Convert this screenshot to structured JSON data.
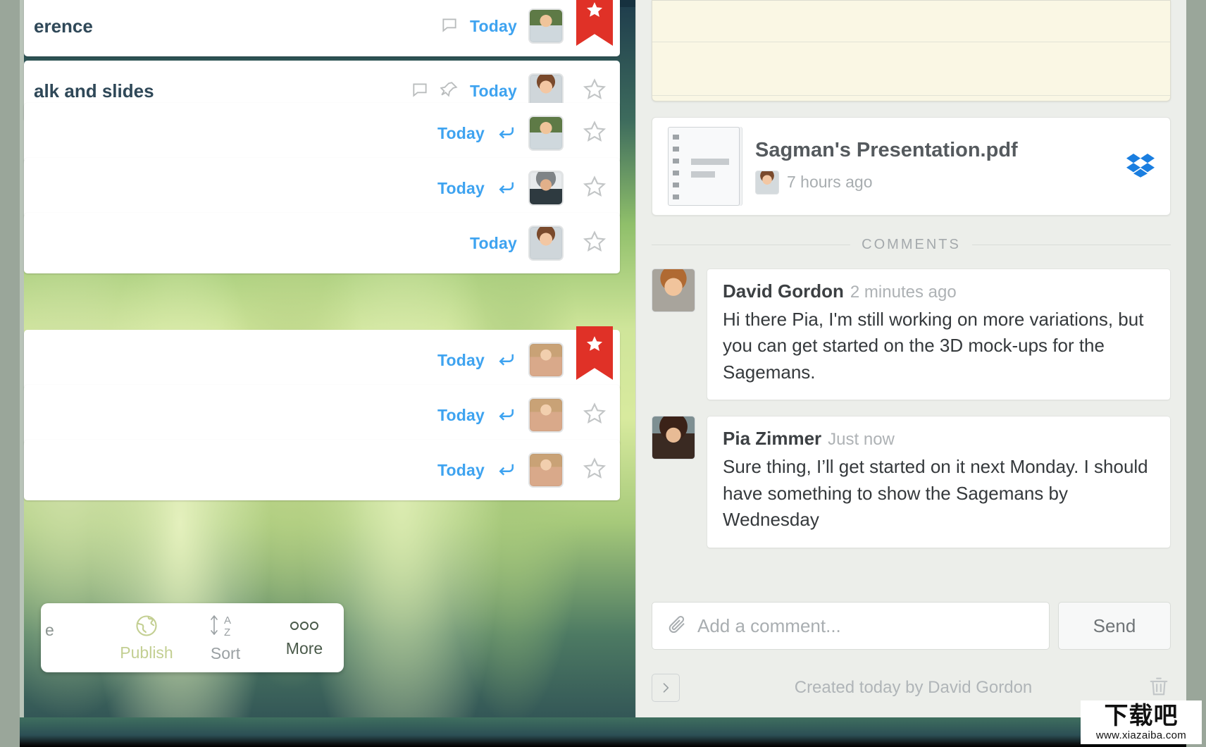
{
  "app": {
    "name": "Wunderlist task detail"
  },
  "left_panel": {
    "rows": [
      {
        "title": "erence",
        "date": "Today",
        "has_comment_icon": true,
        "has_pin_icon": false,
        "has_reply_icon": false,
        "starred": true,
        "avatar": "man-outdoor"
      },
      {
        "title": "alk and slides",
        "date": "Today",
        "has_comment_icon": true,
        "has_pin_icon": true,
        "has_reply_icon": false,
        "starred": false,
        "avatar": "woman-ponytail"
      },
      {
        "title": "",
        "date": "Today",
        "has_comment_icon": false,
        "has_pin_icon": false,
        "has_reply_icon": true,
        "starred": false,
        "avatar": "man-outdoor"
      },
      {
        "title": "",
        "date": "Today",
        "has_comment_icon": false,
        "has_pin_icon": false,
        "has_reply_icon": true,
        "starred": false,
        "avatar": "man-beanie"
      },
      {
        "title": "",
        "date": "Today",
        "has_comment_icon": false,
        "has_pin_icon": false,
        "has_reply_icon": false,
        "starred": false,
        "avatar": "woman-ponytail"
      },
      {
        "title": "",
        "date": "Today",
        "has_comment_icon": false,
        "has_pin_icon": false,
        "has_reply_icon": true,
        "starred": true,
        "avatar": "woman-long-hair"
      },
      {
        "title": "",
        "date": "Today",
        "has_comment_icon": false,
        "has_pin_icon": false,
        "has_reply_icon": true,
        "starred": false,
        "avatar": "woman-long-hair"
      },
      {
        "title": "",
        "date": "Today",
        "has_comment_icon": false,
        "has_pin_icon": false,
        "has_reply_icon": true,
        "starred": false,
        "avatar": "woman-long-hair"
      }
    ],
    "toolbar": {
      "clipped_label": "e",
      "publish_label": "Publish",
      "sort_label": "Sort",
      "sort_glyph_top": "A",
      "sort_glyph_bottom": "Z",
      "more_label": "More",
      "more_glyph": "ooo"
    }
  },
  "detail_panel": {
    "file": {
      "name": "Sagman's Presentation.pdf",
      "time": "7 hours ago",
      "source_icon": "dropbox-icon"
    },
    "comments_header": "COMMENTS",
    "comments": [
      {
        "author": "David Gordon",
        "time": "2 minutes ago",
        "text": "Hi there Pia, I'm still working on more variations, but you can get started on the 3D mock-ups for the Sagemans."
      },
      {
        "author": "Pia Zimmer",
        "time": "Just now",
        "text": "Sure thing, I’ll get started on it next Monday. I should have something to show the Sagemans by Wednesday"
      }
    ],
    "composer": {
      "placeholder": "Add a comment...",
      "send_label": "Send",
      "attach_icon": "paperclip-icon"
    },
    "footer": {
      "collapse_icon": "chevron-right-icon",
      "created_text": "Created today by David Gordon",
      "delete_icon": "trash-icon"
    }
  },
  "watermark": {
    "cn": "下载吧",
    "url": "www.xiazaiba.com"
  },
  "colors": {
    "accent_blue": "#3ea3f0",
    "star_red": "#e03127",
    "notes_yellow": "#faf7e4",
    "panel_bg": "#eceeea",
    "dropbox_blue": "#1a7ee0"
  }
}
